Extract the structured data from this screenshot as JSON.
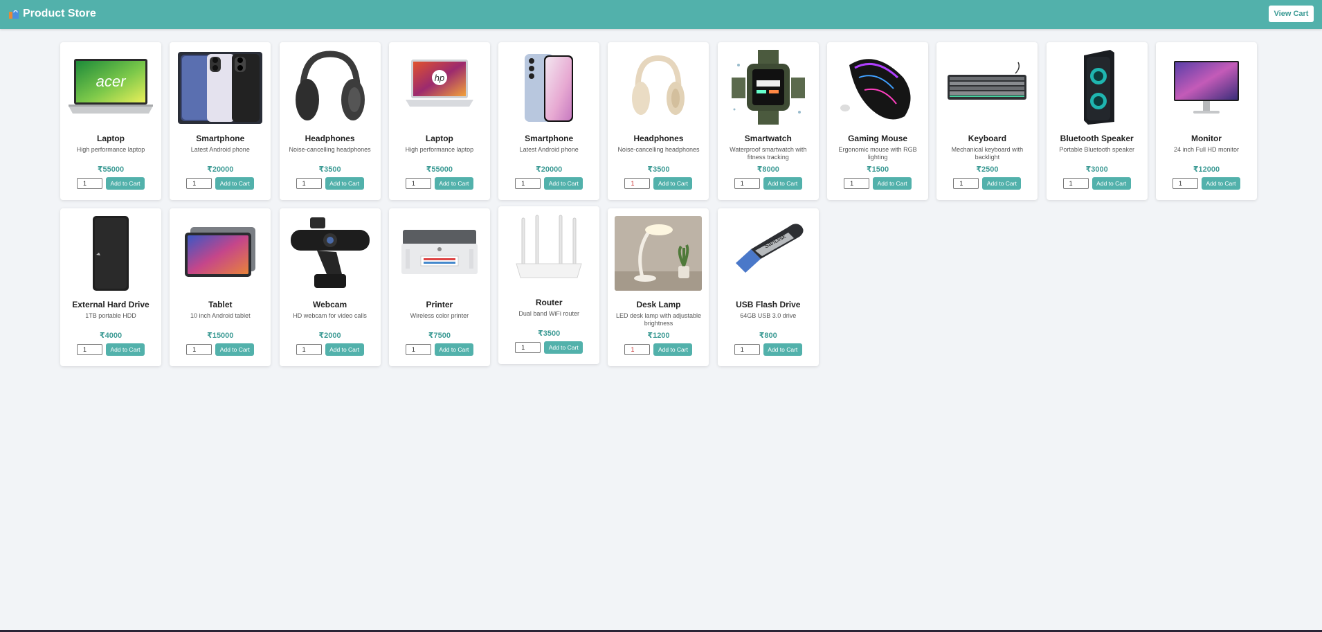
{
  "header": {
    "title": "Product Store",
    "view_cart_label": "View Cart",
    "bg_color": "#52b1ab",
    "brand_icon": "shopping-bag-icon"
  },
  "products": [
    {
      "name": "Laptop",
      "description": "High performance laptop",
      "price": "₹55000",
      "quantity": "1",
      "add_label": "Add to Cart",
      "image": "acer-laptop-image"
    },
    {
      "name": "Smartphone",
      "description": "Latest Android phone",
      "price": "₹20000",
      "quantity": "1",
      "add_label": "Add to Cart",
      "image": "oppo-smartphone-image"
    },
    {
      "name": "Headphones",
      "description": "Noise-cancelling headphones",
      "price": "₹3500",
      "quantity": "1",
      "add_label": "Add to Cart",
      "image": "black-headphones-image"
    },
    {
      "name": "Laptop",
      "description": "High performance laptop",
      "price": "₹55000",
      "quantity": "1",
      "add_label": "Add to Cart",
      "image": "hp-laptop-image"
    },
    {
      "name": "Smartphone",
      "description": "Latest Android phone",
      "price": "₹20000",
      "quantity": "1",
      "add_label": "Add to Cart",
      "image": "galaxy-smartphone-image"
    },
    {
      "name": "Headphones",
      "description": "Noise-cancelling headphones",
      "price": "₹3500",
      "quantity": "1",
      "add_label": "Add to Cart",
      "image": "beige-headphones-image"
    },
    {
      "name": "Smartwatch",
      "description": "Waterproof smartwatch with fitness tracking",
      "price": "₹8000",
      "quantity": "1",
      "add_label": "Add to Cart",
      "image": "smartwatch-image"
    },
    {
      "name": "Gaming Mouse",
      "description": "Ergonomic mouse with RGB lighting",
      "price": "₹1500",
      "quantity": "1",
      "add_label": "Add to Cart",
      "image": "gaming-mouse-image"
    },
    {
      "name": "Keyboard",
      "description": "Mechanical keyboard with backlight",
      "price": "₹2500",
      "quantity": "1",
      "add_label": "Add to Cart",
      "image": "keyboard-image"
    },
    {
      "name": "Bluetooth Speaker",
      "description": "Portable Bluetooth speaker",
      "price": "₹3000",
      "quantity": "1",
      "add_label": "Add to Cart",
      "image": "speaker-image"
    },
    {
      "name": "Monitor",
      "description": "24 inch Full HD monitor",
      "price": "₹12000",
      "quantity": "1",
      "add_label": "Add to Cart",
      "image": "monitor-image"
    },
    {
      "name": "External Hard Drive",
      "description": "1TB portable HDD",
      "price": "₹4000",
      "quantity": "1",
      "add_label": "Add to Cart",
      "image": "hard-drive-image"
    },
    {
      "name": "Tablet",
      "description": "10 inch Android tablet",
      "price": "₹15000",
      "quantity": "1",
      "add_label": "Add to Cart",
      "image": "tablet-image"
    },
    {
      "name": "Webcam",
      "description": "HD webcam for video calls",
      "price": "₹2000",
      "quantity": "1",
      "add_label": "Add to Cart",
      "image": "webcam-image"
    },
    {
      "name": "Printer",
      "description": "Wireless color printer",
      "price": "₹7500",
      "quantity": "1",
      "add_label": "Add to Cart",
      "image": "printer-image"
    },
    {
      "name": "Router",
      "description": "Dual band WiFi router",
      "price": "₹3500",
      "quantity": "1",
      "add_label": "Add to Cart",
      "image": "router-image"
    },
    {
      "name": "Desk Lamp",
      "description": "LED desk lamp with adjustable brightness",
      "price": "₹1200",
      "quantity": "1",
      "add_label": "Add to Cart",
      "image": "desk-lamp-image"
    },
    {
      "name": "USB Flash Drive",
      "description": "64GB USB 3.0 drive",
      "price": "₹800",
      "quantity": "1",
      "add_label": "Add to Cart",
      "image": "usb-drive-image"
    }
  ],
  "image_text": {
    "acer": "acer",
    "hp": "hp",
    "sandisk": "SanDisk"
  },
  "colors": {
    "accent": "#52b1ab",
    "price": "#3d9b95",
    "page_bg": "#f2f4f7"
  }
}
